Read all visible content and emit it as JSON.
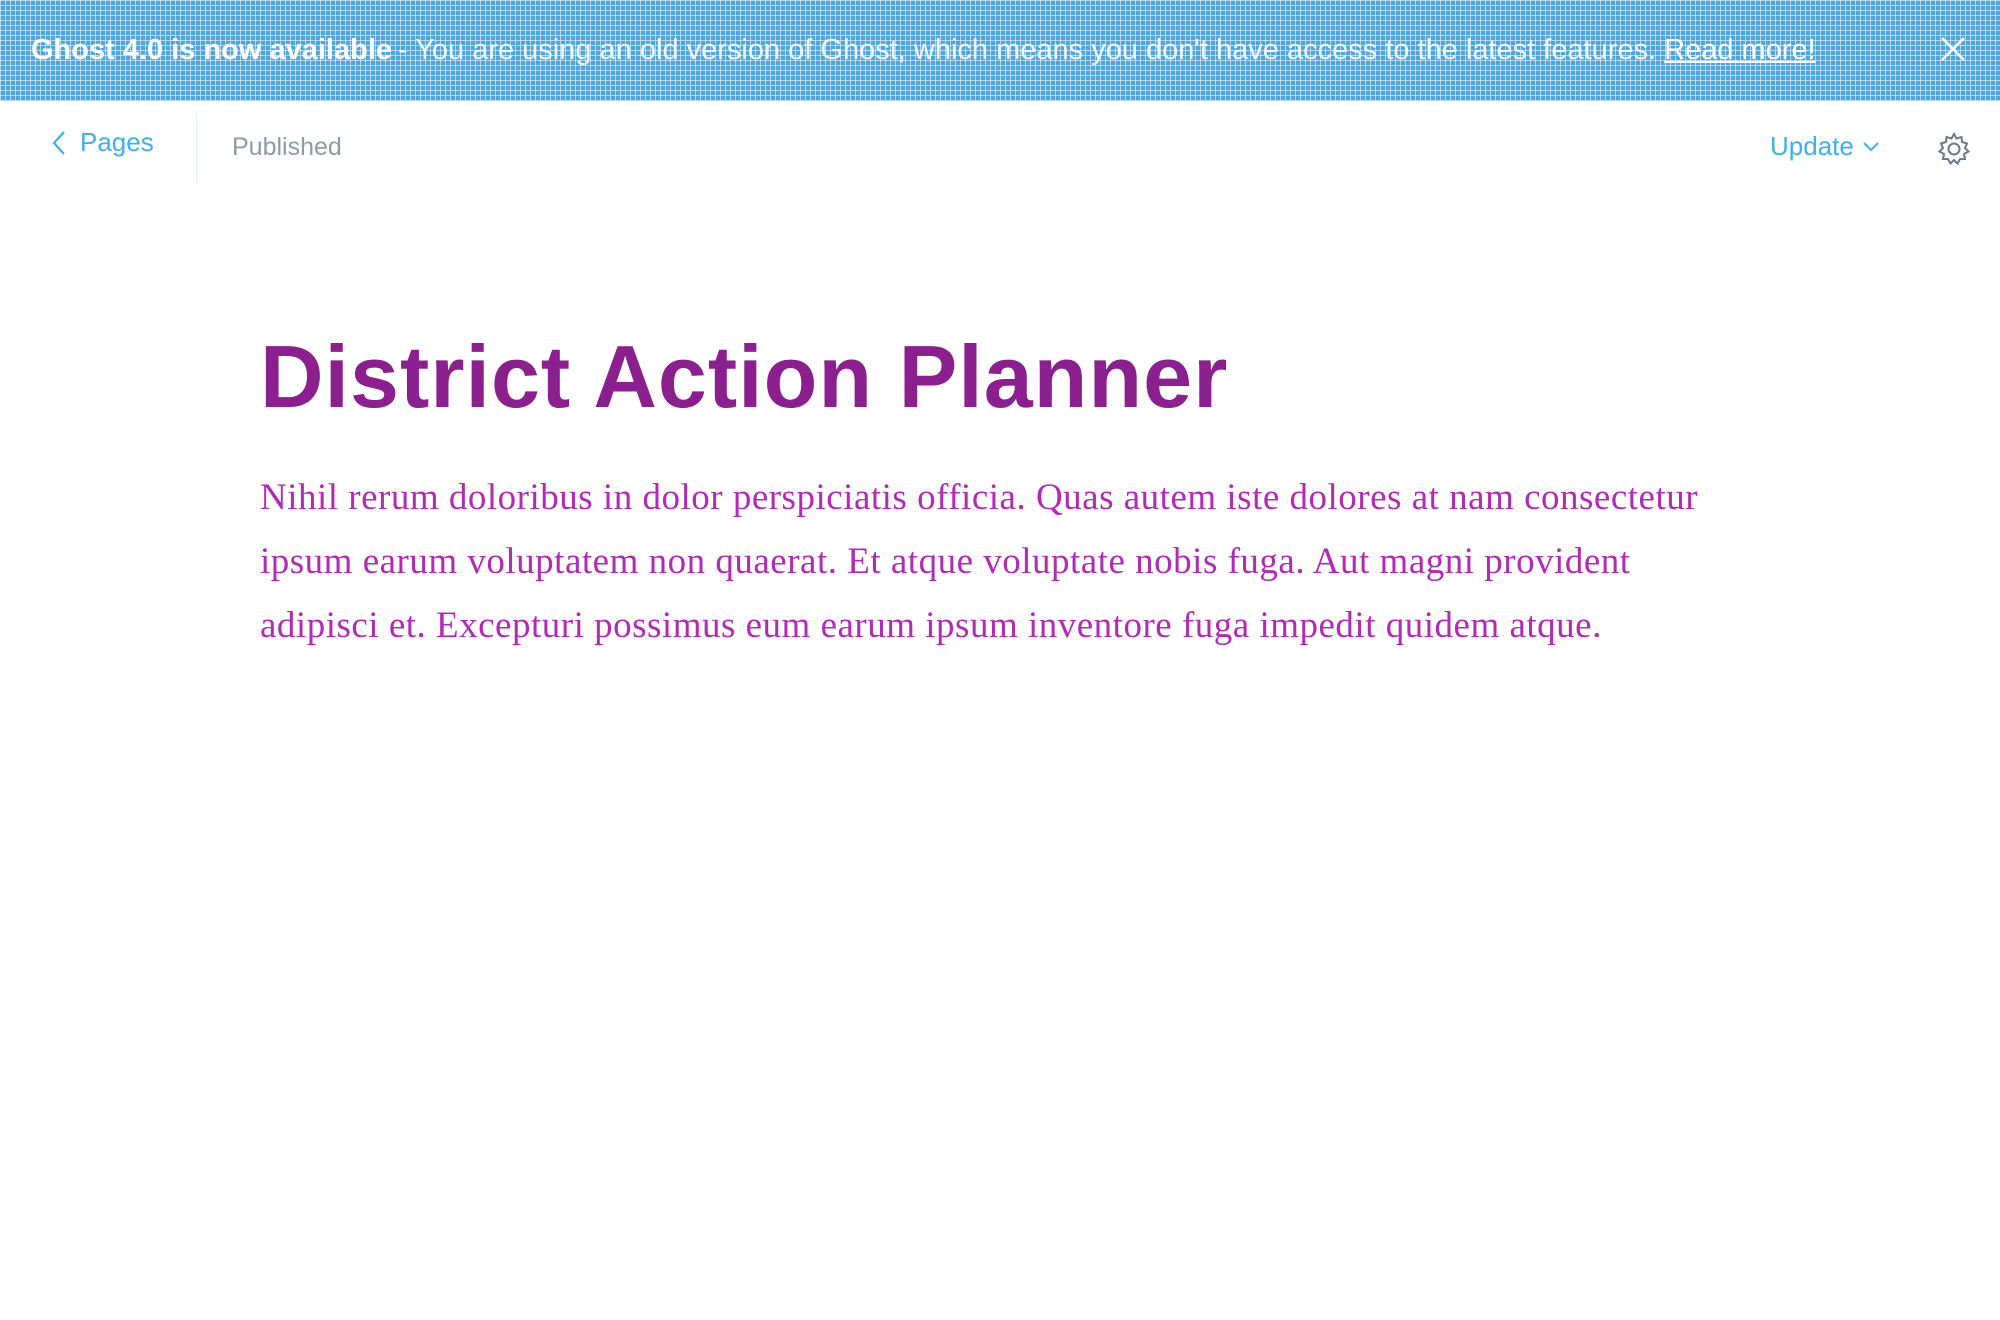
{
  "banner": {
    "headline": "Ghost 4.0 is now available",
    "message": "- You are using an old version of Ghost, which means you don't have access to the latest features.",
    "link_label": "Read more!",
    "close_icon": "close-icon",
    "background_color": "#4fa6dd"
  },
  "header": {
    "back_label": "Pages",
    "back_icon": "chevron-left-icon",
    "status": "Published",
    "update_label": "Update",
    "update_icon": "chevron-down-icon",
    "settings_icon": "gear-icon",
    "accent_color": "#3eb0ef"
  },
  "post": {
    "title": "District Action Planner",
    "body": "Nihil rerum doloribus in dolor perspiciatis officia. Quas autem iste dolores at nam consectetur ipsum earum voluptatem non quaerat. Et atque voluptate nobis fuga. Aut magni provident adipisci et. Excepturi possimus eum earum ipsum inventore fuga impedit quidem atque."
  }
}
